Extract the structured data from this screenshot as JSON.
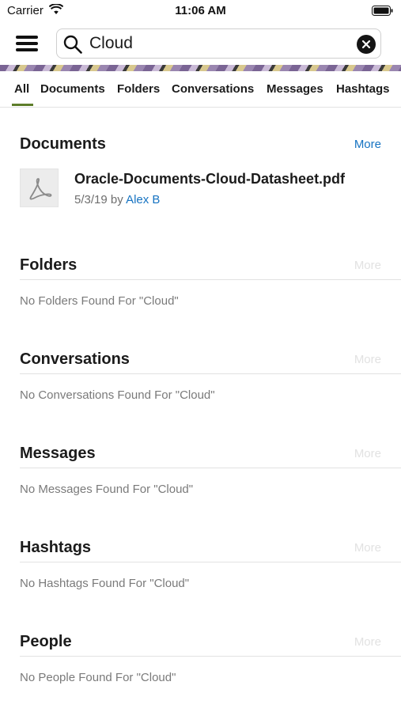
{
  "status_bar": {
    "carrier": "Carrier",
    "time": "11:06 AM",
    "icons": [
      "wifi-icon",
      "battery-icon"
    ]
  },
  "header": {
    "menu_icon": "hamburger-menu-icon",
    "search": {
      "value": "Cloud",
      "placeholder": "Search",
      "search_icon": "search-icon",
      "clear_icon": "clear-icon"
    }
  },
  "tabs": [
    {
      "label": "All",
      "selected": true
    },
    {
      "label": "Documents",
      "selected": false
    },
    {
      "label": "Folders",
      "selected": false
    },
    {
      "label": "Conversations",
      "selected": false
    },
    {
      "label": "Messages",
      "selected": false
    },
    {
      "label": "Hashtags",
      "selected": false
    }
  ],
  "sections": {
    "documents": {
      "title": "Documents",
      "more": "More",
      "items": [
        {
          "name": "Oracle-Documents-Cloud-Datasheet.pdf",
          "date": "5/3/19",
          "by": "by",
          "author": "Alex B",
          "icon": "pdf-icon"
        }
      ]
    },
    "folders": {
      "title": "Folders",
      "more": "More",
      "empty": "No Folders Found For \"Cloud\""
    },
    "conversations": {
      "title": "Conversations",
      "more": "More",
      "empty": "No Conversations Found For \"Cloud\""
    },
    "messages": {
      "title": "Messages",
      "more": "More",
      "empty": "No Messages Found For \"Cloud\""
    },
    "hashtags": {
      "title": "Hashtags",
      "more": "More",
      "empty": "No Hashtags Found For \"Cloud\""
    },
    "people": {
      "title": "People",
      "more": "More",
      "empty": "No People Found For \"Cloud\""
    }
  },
  "colors": {
    "accent": "#1673c2",
    "tab_indicator": "#5d7d2a",
    "disabled": "#e2e2e2",
    "muted_text": "#7a7a7a"
  }
}
